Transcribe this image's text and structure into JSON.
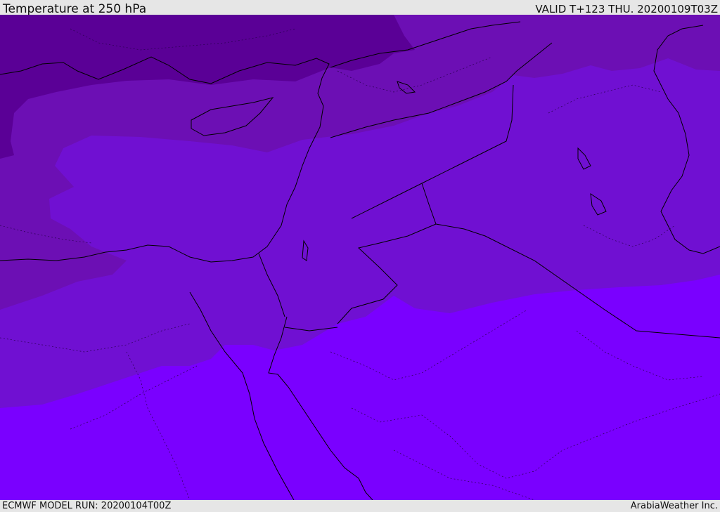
{
  "header": {
    "title": "Temperature at 250 hPa",
    "valid": "VALID T+123 THU. 20200109T03Z"
  },
  "footer": {
    "model_run": "ECMWF MODEL RUN: 20200104T00Z",
    "credit": "ArabiaWeather Inc."
  },
  "map": {
    "palette": {
      "coldest": "#5a0096",
      "cold": "#6c0fb4",
      "mid": "#7010d2",
      "warm": "#7a00ff",
      "coast": "#000000",
      "border": "#2a0050"
    }
  }
}
